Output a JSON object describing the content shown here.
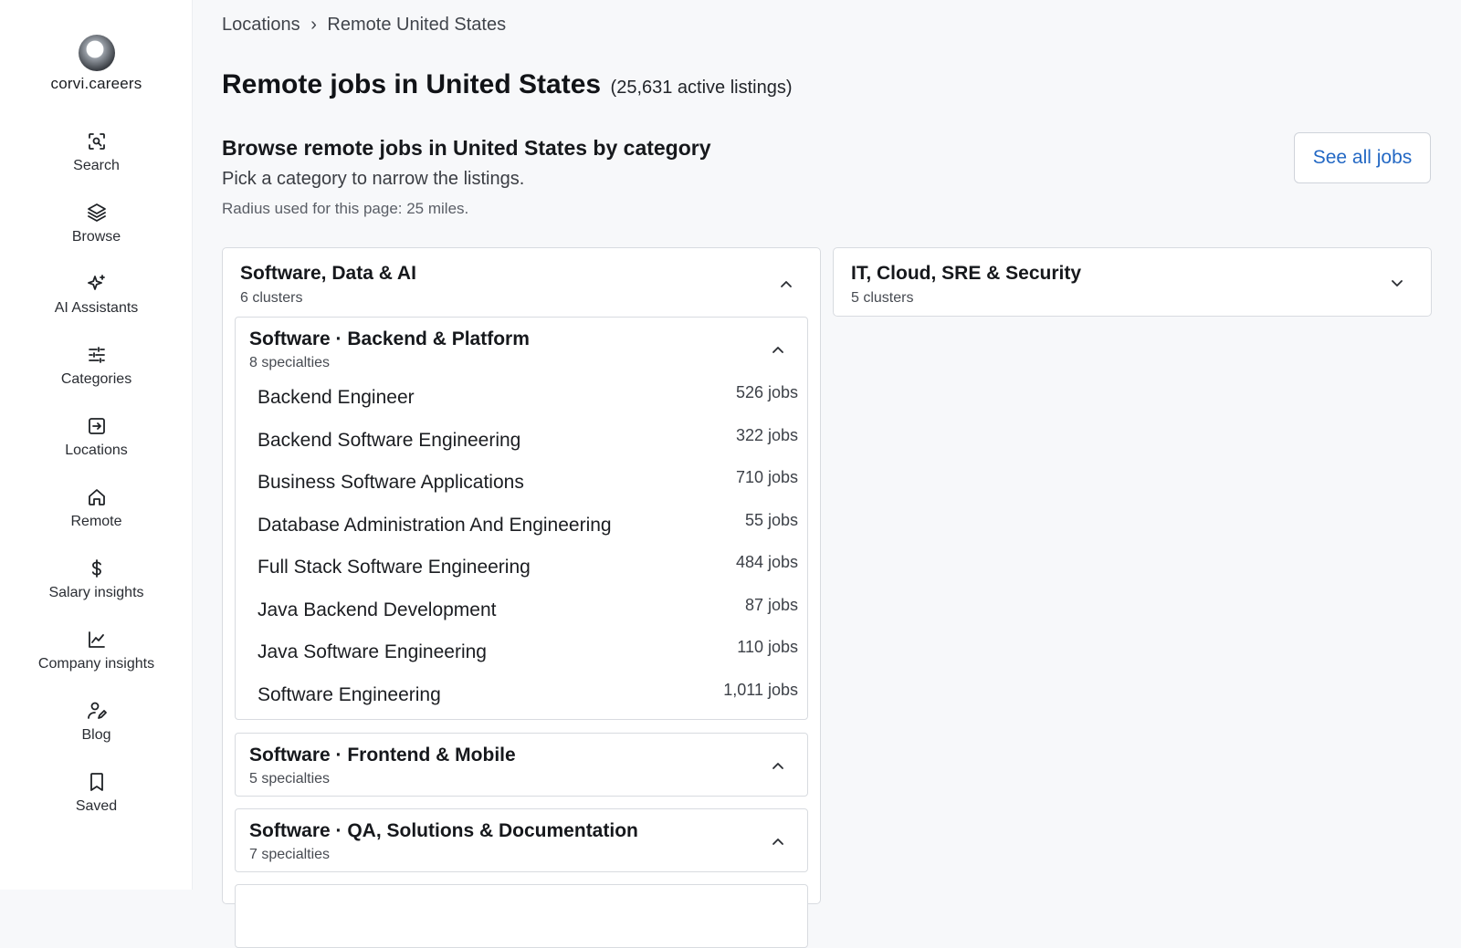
{
  "brand": {
    "name": "corvi.careers"
  },
  "nav": [
    {
      "label": "Search",
      "icon": "search-icon"
    },
    {
      "label": "Browse",
      "icon": "layers-icon"
    },
    {
      "label": "AI Assistants",
      "icon": "sparkles-icon"
    },
    {
      "label": "Categories",
      "icon": "sliders-icon"
    },
    {
      "label": "Locations",
      "icon": "arrow-in-box-icon"
    },
    {
      "label": "Remote",
      "icon": "home-icon"
    },
    {
      "label": "Salary insights",
      "icon": "dollar-icon"
    },
    {
      "label": "Company insights",
      "icon": "chart-line-icon"
    },
    {
      "label": "Blog",
      "icon": "user-pen-icon"
    },
    {
      "label": "Saved",
      "icon": "bookmark-icon"
    }
  ],
  "breadcrumb": {
    "parent": "Locations",
    "separator": "›",
    "current": "Remote United States"
  },
  "page": {
    "title": "Remote jobs in United States",
    "count_text": "(25,631 active listings)"
  },
  "section": {
    "title": "Browse remote jobs in United States by category",
    "subtitle": "Pick a category to narrow the listings.",
    "note": "Radius used for this page: 25 miles.",
    "see_all_label": "See all jobs"
  },
  "categories": [
    {
      "title": "Software, Data & AI",
      "meta": "6 clusters",
      "expanded": true,
      "clusters": [
        {
          "title": "Software · Backend & Platform",
          "meta": "8 specialties",
          "expanded": true,
          "specialties": [
            {
              "name": "Backend Engineer",
              "count": "526 jobs"
            },
            {
              "name": "Backend Software Engineering",
              "count": "322 jobs"
            },
            {
              "name": "Business Software Applications",
              "count": "710 jobs"
            },
            {
              "name": "Database Administration And Engineering",
              "count": "55 jobs"
            },
            {
              "name": "Full Stack Software Engineering",
              "count": "484 jobs"
            },
            {
              "name": "Java Backend Development",
              "count": "87 jobs"
            },
            {
              "name": "Java Software Engineering",
              "count": "110 jobs"
            },
            {
              "name": "Software Engineering",
              "count": "1,011 jobs"
            }
          ]
        },
        {
          "title": "Software · Frontend & Mobile",
          "meta": "5 specialties",
          "expanded": false
        },
        {
          "title": "Software · QA, Solutions & Documentation",
          "meta": "7 specialties",
          "expanded": false
        }
      ]
    },
    {
      "title": "IT, Cloud, SRE & Security",
      "meta": "5 clusters",
      "expanded": false
    }
  ]
}
